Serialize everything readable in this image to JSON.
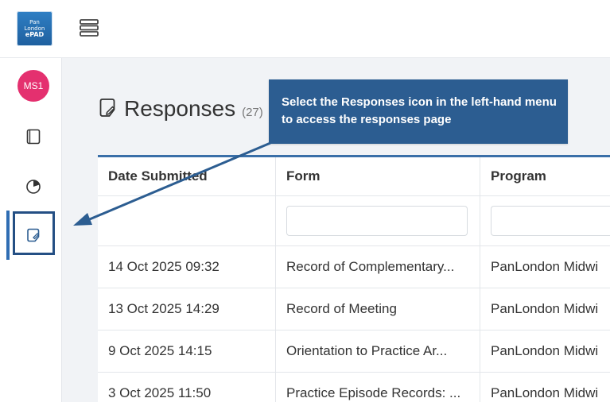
{
  "logo": {
    "line1": "Pan",
    "line2": "London",
    "line3": "ePAD"
  },
  "user": {
    "initials": "MS1"
  },
  "page": {
    "title": "Responses",
    "count": "(27)"
  },
  "callout": {
    "text": "Select the Responses icon in the left-hand menu to access the responses page"
  },
  "table": {
    "columns": [
      "Date Submitted",
      "Form",
      "Program"
    ],
    "rows": [
      {
        "date": "14 Oct 2025 09:32",
        "form": "Record of Complementary...",
        "program": "PanLondon Midwi"
      },
      {
        "date": "13 Oct 2025 14:29",
        "form": "Record of Meeting",
        "program": "PanLondon Midwi"
      },
      {
        "date": "9 Oct 2025 14:15",
        "form": "Orientation to Practice Ar...",
        "program": "PanLondon Midwi"
      },
      {
        "date": "3 Oct 2025 11:50",
        "form": "Practice Episode Records: ...",
        "program": "PanLondon Midwi"
      }
    ]
  },
  "colors": {
    "primary": "#2c5d91",
    "avatar": "#e4306f",
    "highlight": "#244f84"
  },
  "icons": {
    "menu": "hamburger-icon",
    "forms": "document-icon",
    "progress": "progress-icon",
    "responses": "response-note-icon"
  }
}
